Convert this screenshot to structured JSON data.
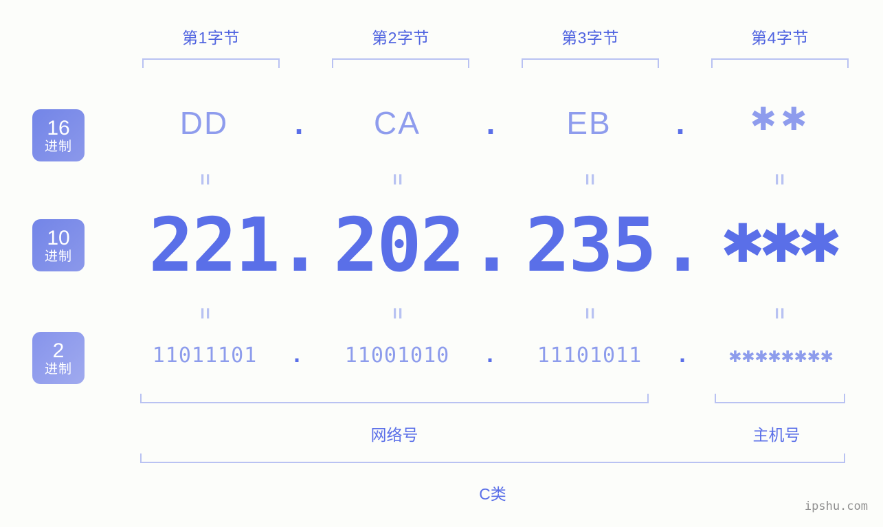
{
  "page": {
    "background": "#fcfdfa",
    "accent": "#5a6fe8",
    "accent_light": "#8e9ced",
    "bracket_color": "#b9c2f2",
    "watermark": "ipshu.com"
  },
  "byte_headers": [
    {
      "label": "第1字节"
    },
    {
      "label": "第2字节"
    },
    {
      "label": "第3字节"
    },
    {
      "label": "第4字节"
    }
  ],
  "bases": [
    {
      "num": "16",
      "sub": "进制"
    },
    {
      "num": "10",
      "sub": "进制"
    },
    {
      "num": "2",
      "sub": "进制"
    }
  ],
  "rows": {
    "hex": {
      "values": [
        "DD",
        "CA",
        "EB",
        "✱✱"
      ],
      "separators": [
        ".",
        ".",
        "."
      ]
    },
    "decimal": {
      "values": [
        "221",
        "202",
        "235",
        "✱✱✱"
      ],
      "separators": [
        ".",
        ".",
        "."
      ]
    },
    "binary": {
      "values": [
        "11011101",
        "11001010",
        "11101011",
        "✱✱✱✱✱✱✱✱"
      ],
      "separators": [
        ".",
        ".",
        "."
      ]
    }
  },
  "equals": {
    "mark": "="
  },
  "groups": [
    {
      "label": "网络号"
    },
    {
      "label": "主机号"
    }
  ],
  "class": {
    "label": "C类"
  }
}
